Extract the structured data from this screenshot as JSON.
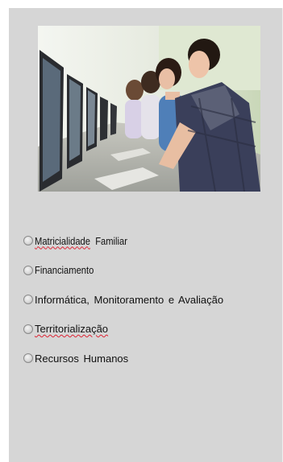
{
  "photo": {
    "icon": "computer-lab-students-photo"
  },
  "options": [
    {
      "label": "Matricialidade",
      "label2": "Familiar",
      "selected": false
    },
    {
      "label": "Financiamento",
      "selected": false
    },
    {
      "label": "Informática, Monitoramento e Avaliação",
      "selected": false
    },
    {
      "label": "Territorialização",
      "selected": false
    },
    {
      "label": "Recursos Humanos",
      "selected": false
    }
  ],
  "colors": {
    "panel_background": "#d6d6d6",
    "spellcheck_underline": "#dd2233"
  }
}
